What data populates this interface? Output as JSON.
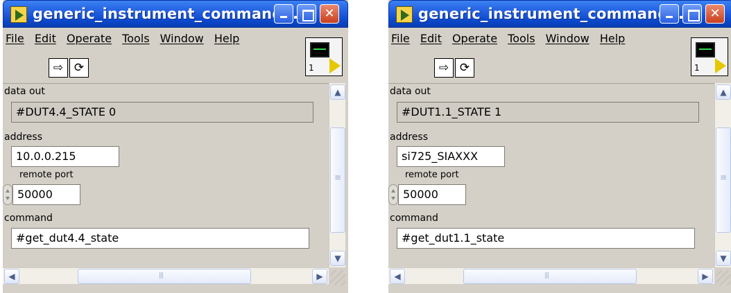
{
  "windows": [
    {
      "title": "generic_instrument_commande...",
      "menu": [
        "File",
        "Edit",
        "Operate",
        "Tools",
        "Window",
        "Help"
      ],
      "toolbar": {
        "run_glyph": "⇨",
        "run_continuous_glyph": "⟳"
      },
      "vi_icon": {
        "icon": "vi-connector-pane-icon",
        "number": "1"
      },
      "fields": {
        "data_out": {
          "label": "data out",
          "value": "#DUT4.4_STATE 0"
        },
        "address": {
          "label": "address",
          "value": "10.0.0.215"
        },
        "remote_port": {
          "label": "remote port",
          "value": "50000"
        },
        "command": {
          "label": "command",
          "value": "#get_dut4.4_state"
        }
      },
      "scroll": {
        "up": "▲",
        "down": "▼",
        "left": "◀",
        "right": "▶"
      }
    },
    {
      "title": "generic_instrument_commande...",
      "menu": [
        "File",
        "Edit",
        "Operate",
        "Tools",
        "Window",
        "Help"
      ],
      "toolbar": {
        "run_glyph": "⇨",
        "run_continuous_glyph": "⟳"
      },
      "vi_icon": {
        "icon": "vi-connector-pane-icon",
        "number": "1"
      },
      "fields": {
        "data_out": {
          "label": "data out",
          "value": "#DUT1.1_STATE 1"
        },
        "address": {
          "label": "address",
          "value": "si725_SIAXXX"
        },
        "remote_port": {
          "label": "remote port",
          "value": "50000"
        },
        "command": {
          "label": "command",
          "value": "#get_dut1.1_state"
        }
      },
      "scroll": {
        "up": "▲",
        "down": "▼",
        "left": "◀",
        "right": "▶"
      }
    }
  ],
  "colors": {
    "titlebar": "#0a46c8",
    "window_bg": "#d4d0c8",
    "close_button": "#c8401e"
  }
}
